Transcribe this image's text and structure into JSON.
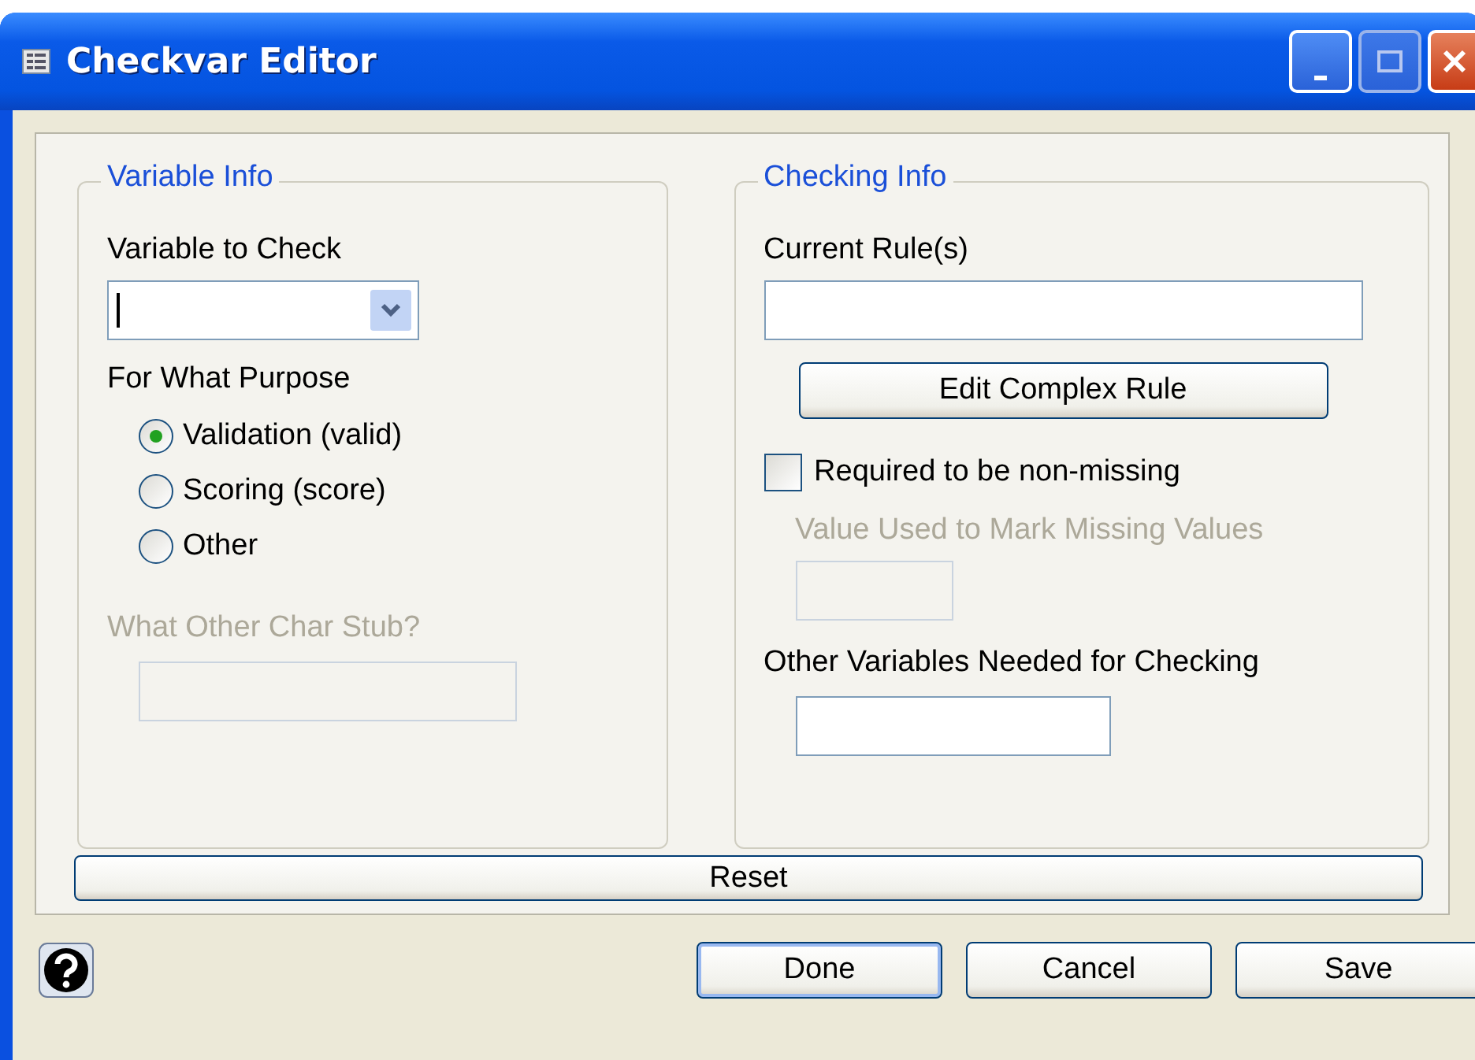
{
  "window": {
    "title": "Checkvar Editor"
  },
  "variable_info": {
    "title": "Variable Info",
    "variable_label": "Variable to Check",
    "purpose_label": "For What Purpose",
    "purposes": [
      {
        "label": "Validation (valid)",
        "selected": true
      },
      {
        "label": "Scoring (score)",
        "selected": false
      },
      {
        "label": "Other",
        "selected": false
      }
    ],
    "stub": {
      "label": "What Other Char Stub?",
      "disabled": true
    }
  },
  "checking_info": {
    "title": "Checking Info",
    "rules_label": "Current Rule(s)",
    "edit_button": "Edit Complex Rule",
    "required": {
      "label": "Required to be non-missing",
      "checked": false
    },
    "missing_value": {
      "label": "Value Used to Mark Missing Values",
      "disabled": true
    },
    "other_vars": {
      "label": "Other Variables Needed for Checking",
      "disabled": false
    }
  },
  "reset_button": "Reset",
  "buttons": [
    {
      "label": "Done",
      "default": true
    },
    {
      "label": "Cancel",
      "default": false
    },
    {
      "label": "Save",
      "default": false
    }
  ]
}
